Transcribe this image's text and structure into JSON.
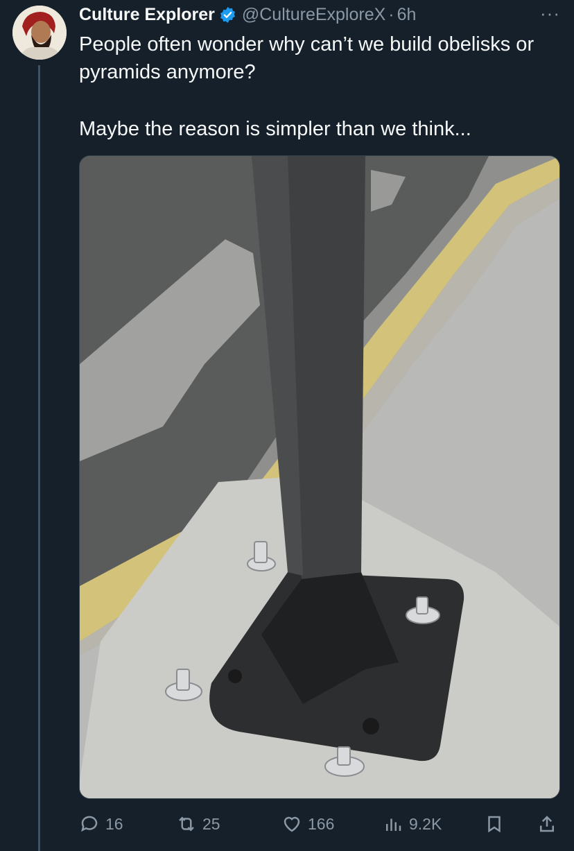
{
  "tweet": {
    "author_name": "Culture Explorer",
    "handle": "@CultureExploreX",
    "separator": "·",
    "time": "6h",
    "more_label": "···",
    "text_line1": "People often wonder why can’t we build obelisks or pyramids anymore?",
    "text_line2": "Maybe the reason is simpler than we think..."
  },
  "actions": {
    "replies": "16",
    "retweets": "25",
    "likes": "166",
    "views": "9.2K"
  },
  "colors": {
    "background": "#15202b",
    "verified_badge": "#1d9bf0",
    "muted_text": "#8b98a5"
  }
}
